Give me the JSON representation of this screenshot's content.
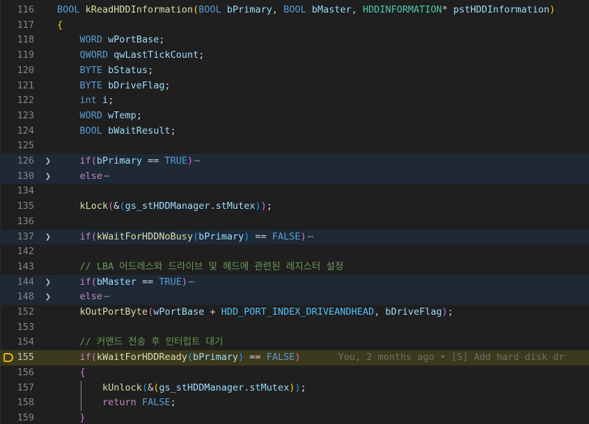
{
  "editor": {
    "colors": {
      "background": "#1f1f1f",
      "line_number": "#858585",
      "folded_region_bg": "#1e2935",
      "current_line_bg": "#3c3a1c",
      "breakpoint": "#e6b422",
      "keyword": "#569cd6",
      "type": "#4ec9b0",
      "function": "#dcdcaa",
      "variable": "#9cdcfe",
      "macro": "#4fc1ff",
      "comment": "#6a9955"
    },
    "fold_chevron_icon": "chevron-right-icon",
    "fold_ellipsis": "⋯",
    "blame_text": "You, 2 months ago • [S] Add hard disk dr",
    "lines": [
      {
        "num": "116",
        "tokens": [
          [
            "kw",
            "BOOL"
          ],
          [
            "p",
            " "
          ],
          [
            "fn",
            "kReadHDDInformation"
          ],
          [
            "b1",
            "("
          ],
          [
            "kw",
            "BOOL"
          ],
          [
            "p",
            " "
          ],
          [
            "var",
            "bPrimary"
          ],
          [
            "p",
            ", "
          ],
          [
            "kw",
            "BOOL"
          ],
          [
            "p",
            " "
          ],
          [
            "var",
            "bMaster"
          ],
          [
            "p",
            ", "
          ],
          [
            "type",
            "HDDINFORMATION"
          ],
          [
            "p",
            "* "
          ],
          [
            "var",
            "pstHDDInformation"
          ],
          [
            "b1",
            ")"
          ]
        ]
      },
      {
        "num": "117",
        "tokens": [
          [
            "b1",
            "{"
          ]
        ]
      },
      {
        "num": "118",
        "tokens": [
          [
            "p",
            "    "
          ],
          [
            "kw",
            "WORD"
          ],
          [
            "p",
            " "
          ],
          [
            "var",
            "wPortBase"
          ],
          [
            "p",
            ";"
          ]
        ]
      },
      {
        "num": "119",
        "tokens": [
          [
            "p",
            "    "
          ],
          [
            "kw",
            "QWORD"
          ],
          [
            "p",
            " "
          ],
          [
            "var",
            "qwLastTickCount"
          ],
          [
            "p",
            ";"
          ]
        ]
      },
      {
        "num": "120",
        "tokens": [
          [
            "p",
            "    "
          ],
          [
            "kw",
            "BYTE"
          ],
          [
            "p",
            " "
          ],
          [
            "var",
            "bStatus"
          ],
          [
            "p",
            ";"
          ]
        ]
      },
      {
        "num": "121",
        "tokens": [
          [
            "p",
            "    "
          ],
          [
            "kw",
            "BYTE"
          ],
          [
            "p",
            " "
          ],
          [
            "var",
            "bDriveFlag"
          ],
          [
            "p",
            ";"
          ]
        ]
      },
      {
        "num": "122",
        "tokens": [
          [
            "p",
            "    "
          ],
          [
            "kw",
            "int"
          ],
          [
            "p",
            " "
          ],
          [
            "var",
            "i"
          ],
          [
            "p",
            ";"
          ]
        ]
      },
      {
        "num": "123",
        "tokens": [
          [
            "p",
            "    "
          ],
          [
            "kw",
            "WORD"
          ],
          [
            "p",
            " "
          ],
          [
            "var",
            "wTemp"
          ],
          [
            "p",
            ";"
          ]
        ]
      },
      {
        "num": "124",
        "tokens": [
          [
            "p",
            "    "
          ],
          [
            "kw",
            "BOOL"
          ],
          [
            "p",
            " "
          ],
          [
            "var",
            "bWaitResult"
          ],
          [
            "p",
            ";"
          ]
        ]
      },
      {
        "num": "125",
        "tokens": []
      },
      {
        "num": "126",
        "fold": true,
        "highlight": true,
        "ellipsis": true,
        "tokens": [
          [
            "p",
            "    "
          ],
          [
            "ctl",
            "if"
          ],
          [
            "b2",
            "("
          ],
          [
            "var",
            "bPrimary"
          ],
          [
            "p",
            " == "
          ],
          [
            "c",
            "TRUE"
          ],
          [
            "b2",
            ")"
          ]
        ]
      },
      {
        "num": "130",
        "fold": true,
        "highlight": true,
        "ellipsis": true,
        "tokens": [
          [
            "p",
            "    "
          ],
          [
            "ctl",
            "else"
          ]
        ]
      },
      {
        "num": "134",
        "tokens": []
      },
      {
        "num": "135",
        "tokens": [
          [
            "p",
            "    "
          ],
          [
            "fn",
            "kLock"
          ],
          [
            "b2",
            "("
          ],
          [
            "p",
            "&"
          ],
          [
            "b3",
            "("
          ],
          [
            "var",
            "gs_stHDDManager"
          ],
          [
            "p",
            "."
          ],
          [
            "var",
            "stMutex"
          ],
          [
            "b3",
            ")"
          ],
          [
            "b2",
            ")"
          ],
          [
            "p",
            ";"
          ]
        ]
      },
      {
        "num": "136",
        "tokens": []
      },
      {
        "num": "137",
        "fold": true,
        "highlight": true,
        "ellipsis": true,
        "tokens": [
          [
            "p",
            "    "
          ],
          [
            "ctl",
            "if"
          ],
          [
            "b2",
            "("
          ],
          [
            "fn",
            "kWaitForHDDNoBusy"
          ],
          [
            "b3",
            "("
          ],
          [
            "var",
            "bPrimary"
          ],
          [
            "b3",
            ")"
          ],
          [
            "p",
            " == "
          ],
          [
            "c",
            "FALSE"
          ],
          [
            "b2",
            ")"
          ]
        ]
      },
      {
        "num": "142",
        "tokens": []
      },
      {
        "num": "143",
        "tokens": [
          [
            "p",
            "    "
          ],
          [
            "cmt",
            "// LBA 어드레스와 드라이브 및 헤드에 관련된 레지스터 설정"
          ]
        ]
      },
      {
        "num": "144",
        "fold": true,
        "highlight": true,
        "ellipsis": true,
        "tokens": [
          [
            "p",
            "    "
          ],
          [
            "ctl",
            "if"
          ],
          [
            "b2",
            "("
          ],
          [
            "var",
            "bMaster"
          ],
          [
            "p",
            " == "
          ],
          [
            "c",
            "TRUE"
          ],
          [
            "b2",
            ")"
          ]
        ]
      },
      {
        "num": "148",
        "fold": true,
        "highlight": true,
        "ellipsis": true,
        "tokens": [
          [
            "p",
            "    "
          ],
          [
            "ctl",
            "else"
          ]
        ]
      },
      {
        "num": "152",
        "tokens": [
          [
            "p",
            "    "
          ],
          [
            "fn",
            "kOutPortByte"
          ],
          [
            "b2",
            "("
          ],
          [
            "var",
            "wPortBase"
          ],
          [
            "p",
            " + "
          ],
          [
            "mac",
            "HDD_PORT_INDEX_DRIVEANDHEAD"
          ],
          [
            "p",
            ", "
          ],
          [
            "var",
            "bDriveFlag"
          ],
          [
            "b2",
            ")"
          ],
          [
            "p",
            ";"
          ]
        ]
      },
      {
        "num": "153",
        "tokens": []
      },
      {
        "num": "154",
        "tokens": [
          [
            "p",
            "    "
          ],
          [
            "cmt",
            "// 커맨드 전송 후 인터럽트 대기"
          ]
        ]
      },
      {
        "num": "155",
        "current": true,
        "breakpoint": true,
        "blame": true,
        "tokens": [
          [
            "p",
            "    "
          ],
          [
            "ctl",
            "if"
          ],
          [
            "b2",
            "("
          ],
          [
            "fn",
            "kWaitForHDDReady"
          ],
          [
            "b3",
            "("
          ],
          [
            "var",
            "bPrimary"
          ],
          [
            "b3",
            ")"
          ],
          [
            "p",
            " == "
          ],
          [
            "c",
            "FALSE"
          ],
          [
            "b2",
            ")"
          ]
        ]
      },
      {
        "num": "156",
        "tokens": [
          [
            "p",
            "    "
          ],
          [
            "b2",
            "{"
          ]
        ]
      },
      {
        "num": "157",
        "guide": true,
        "tokens": [
          [
            "p",
            "        "
          ],
          [
            "fn",
            "kUnlock"
          ],
          [
            "b3",
            "("
          ],
          [
            "p",
            "&"
          ],
          [
            "b1",
            "("
          ],
          [
            "var",
            "gs_stHDDManager"
          ],
          [
            "p",
            "."
          ],
          [
            "var",
            "stMutex"
          ],
          [
            "b1",
            ")"
          ],
          [
            "b3",
            ")"
          ],
          [
            "p",
            ";"
          ]
        ]
      },
      {
        "num": "158",
        "guide": true,
        "tokens": [
          [
            "p",
            "        "
          ],
          [
            "ctl",
            "return"
          ],
          [
            "p",
            " "
          ],
          [
            "c",
            "FALSE"
          ],
          [
            "p",
            ";"
          ]
        ]
      },
      {
        "num": "159",
        "tokens": [
          [
            "p",
            "    "
          ],
          [
            "b2",
            "}"
          ]
        ]
      }
    ]
  }
}
